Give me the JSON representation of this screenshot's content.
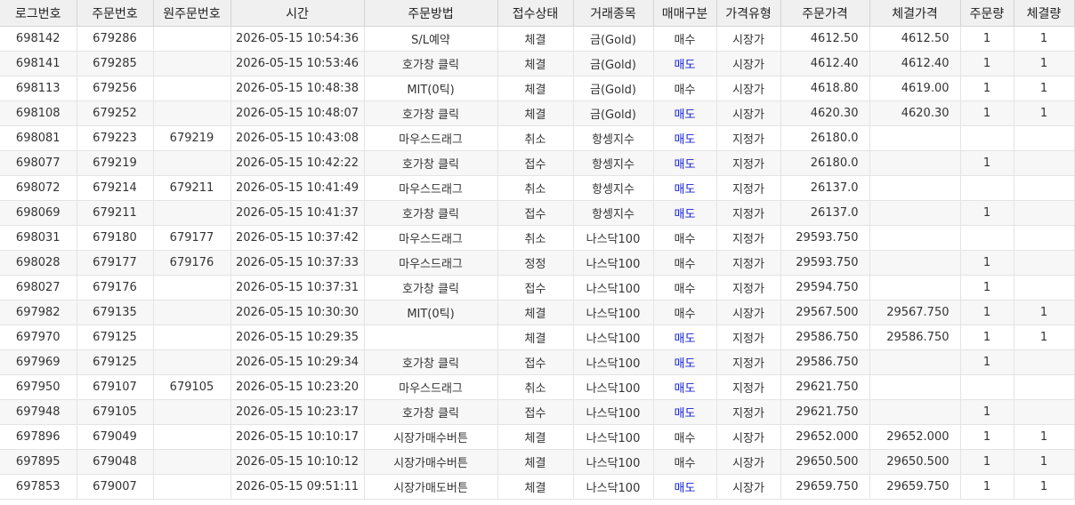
{
  "colors": {
    "sell_text": "#1a24d6",
    "header_bg": "#f0f0f0",
    "row_alt_bg": "#f7f7f7"
  },
  "columns": [
    {
      "key": "log_no",
      "label": "로그번호"
    },
    {
      "key": "order_no",
      "label": "주문번호"
    },
    {
      "key": "orig_order_no",
      "label": "원주문번호"
    },
    {
      "key": "time",
      "label": "시간"
    },
    {
      "key": "method",
      "label": "주문방법"
    },
    {
      "key": "status",
      "label": "접수상태"
    },
    {
      "key": "symbol",
      "label": "거래종목"
    },
    {
      "key": "side",
      "label": "매매구분"
    },
    {
      "key": "price_type",
      "label": "가격유형"
    },
    {
      "key": "order_price",
      "label": "주문가격"
    },
    {
      "key": "fill_price",
      "label": "체결가격"
    },
    {
      "key": "order_qty",
      "label": "주문량"
    },
    {
      "key": "fill_qty",
      "label": "체결량"
    }
  ],
  "rows": [
    {
      "log_no": "698142",
      "order_no": "679286",
      "orig_order_no": "",
      "time": "2026-05-15 10:54:36",
      "method": "S/L예약",
      "status": "체결",
      "symbol": "금(Gold)",
      "side": "매수",
      "price_type": "시장가",
      "order_price": "4612.50",
      "fill_price": "4612.50",
      "order_qty": "1",
      "fill_qty": "1"
    },
    {
      "log_no": "698141",
      "order_no": "679285",
      "orig_order_no": "",
      "time": "2026-05-15 10:53:46",
      "method": "호가창 클릭",
      "status": "체결",
      "symbol": "금(Gold)",
      "side": "매도",
      "price_type": "시장가",
      "order_price": "4612.40",
      "fill_price": "4612.40",
      "order_qty": "1",
      "fill_qty": "1"
    },
    {
      "log_no": "698113",
      "order_no": "679256",
      "orig_order_no": "",
      "time": "2026-05-15 10:48:38",
      "method": "MIT(0틱)",
      "status": "체결",
      "symbol": "금(Gold)",
      "side": "매수",
      "price_type": "시장가",
      "order_price": "4618.80",
      "fill_price": "4619.00",
      "order_qty": "1",
      "fill_qty": "1"
    },
    {
      "log_no": "698108",
      "order_no": "679252",
      "orig_order_no": "",
      "time": "2026-05-15 10:48:07",
      "method": "호가창 클릭",
      "status": "체결",
      "symbol": "금(Gold)",
      "side": "매도",
      "price_type": "시장가",
      "order_price": "4620.30",
      "fill_price": "4620.30",
      "order_qty": "1",
      "fill_qty": "1"
    },
    {
      "log_no": "698081",
      "order_no": "679223",
      "orig_order_no": "679219",
      "time": "2026-05-15 10:43:08",
      "method": "마우스드래그",
      "status": "취소",
      "symbol": "항셍지수",
      "side": "매도",
      "price_type": "지정가",
      "order_price": "26180.0",
      "fill_price": "",
      "order_qty": "",
      "fill_qty": ""
    },
    {
      "log_no": "698077",
      "order_no": "679219",
      "orig_order_no": "",
      "time": "2026-05-15 10:42:22",
      "method": "호가창 클릭",
      "status": "접수",
      "symbol": "항셍지수",
      "side": "매도",
      "price_type": "지정가",
      "order_price": "26180.0",
      "fill_price": "",
      "order_qty": "1",
      "fill_qty": ""
    },
    {
      "log_no": "698072",
      "order_no": "679214",
      "orig_order_no": "679211",
      "time": "2026-05-15 10:41:49",
      "method": "마우스드래그",
      "status": "취소",
      "symbol": "항셍지수",
      "side": "매도",
      "price_type": "지정가",
      "order_price": "26137.0",
      "fill_price": "",
      "order_qty": "",
      "fill_qty": ""
    },
    {
      "log_no": "698069",
      "order_no": "679211",
      "orig_order_no": "",
      "time": "2026-05-15 10:41:37",
      "method": "호가창 클릭",
      "status": "접수",
      "symbol": "항셍지수",
      "side": "매도",
      "price_type": "지정가",
      "order_price": "26137.0",
      "fill_price": "",
      "order_qty": "1",
      "fill_qty": ""
    },
    {
      "log_no": "698031",
      "order_no": "679180",
      "orig_order_no": "679177",
      "time": "2026-05-15 10:37:42",
      "method": "마우스드래그",
      "status": "취소",
      "symbol": "나스닥100",
      "side": "매수",
      "price_type": "지정가",
      "order_price": "29593.750",
      "fill_price": "",
      "order_qty": "",
      "fill_qty": ""
    },
    {
      "log_no": "698028",
      "order_no": "679177",
      "orig_order_no": "679176",
      "time": "2026-05-15 10:37:33",
      "method": "마우스드래그",
      "status": "정정",
      "symbol": "나스닥100",
      "side": "매수",
      "price_type": "지정가",
      "order_price": "29593.750",
      "fill_price": "",
      "order_qty": "1",
      "fill_qty": ""
    },
    {
      "log_no": "698027",
      "order_no": "679176",
      "orig_order_no": "",
      "time": "2026-05-15 10:37:31",
      "method": "호가창 클릭",
      "status": "접수",
      "symbol": "나스닥100",
      "side": "매수",
      "price_type": "지정가",
      "order_price": "29594.750",
      "fill_price": "",
      "order_qty": "1",
      "fill_qty": ""
    },
    {
      "log_no": "697982",
      "order_no": "679135",
      "orig_order_no": "",
      "time": "2026-05-15 10:30:30",
      "method": "MIT(0틱)",
      "status": "체결",
      "symbol": "나스닥100",
      "side": "매수",
      "price_type": "시장가",
      "order_price": "29567.500",
      "fill_price": "29567.750",
      "order_qty": "1",
      "fill_qty": "1"
    },
    {
      "log_no": "697970",
      "order_no": "679125",
      "orig_order_no": "",
      "time": "2026-05-15 10:29:35",
      "method": "",
      "status": "체결",
      "symbol": "나스닥100",
      "side": "매도",
      "price_type": "지정가",
      "order_price": "29586.750",
      "fill_price": "29586.750",
      "order_qty": "1",
      "fill_qty": "1"
    },
    {
      "log_no": "697969",
      "order_no": "679125",
      "orig_order_no": "",
      "time": "2026-05-15 10:29:34",
      "method": "호가창 클릭",
      "status": "접수",
      "symbol": "나스닥100",
      "side": "매도",
      "price_type": "지정가",
      "order_price": "29586.750",
      "fill_price": "",
      "order_qty": "1",
      "fill_qty": ""
    },
    {
      "log_no": "697950",
      "order_no": "679107",
      "orig_order_no": "679105",
      "time": "2026-05-15 10:23:20",
      "method": "마우스드래그",
      "status": "취소",
      "symbol": "나스닥100",
      "side": "매도",
      "price_type": "지정가",
      "order_price": "29621.750",
      "fill_price": "",
      "order_qty": "",
      "fill_qty": ""
    },
    {
      "log_no": "697948",
      "order_no": "679105",
      "orig_order_no": "",
      "time": "2026-05-15 10:23:17",
      "method": "호가창 클릭",
      "status": "접수",
      "symbol": "나스닥100",
      "side": "매도",
      "price_type": "지정가",
      "order_price": "29621.750",
      "fill_price": "",
      "order_qty": "1",
      "fill_qty": ""
    },
    {
      "log_no": "697896",
      "order_no": "679049",
      "orig_order_no": "",
      "time": "2026-05-15 10:10:17",
      "method": "시장가매수버튼",
      "status": "체결",
      "symbol": "나스닥100",
      "side": "매수",
      "price_type": "시장가",
      "order_price": "29652.000",
      "fill_price": "29652.000",
      "order_qty": "1",
      "fill_qty": "1"
    },
    {
      "log_no": "697895",
      "order_no": "679048",
      "orig_order_no": "",
      "time": "2026-05-15 10:10:12",
      "method": "시장가매수버튼",
      "status": "체결",
      "symbol": "나스닥100",
      "side": "매수",
      "price_type": "시장가",
      "order_price": "29650.500",
      "fill_price": "29650.500",
      "order_qty": "1",
      "fill_qty": "1"
    },
    {
      "log_no": "697853",
      "order_no": "679007",
      "orig_order_no": "",
      "time": "2026-05-15 09:51:11",
      "method": "시장가매도버튼",
      "status": "체결",
      "symbol": "나스닥100",
      "side": "매도",
      "price_type": "시장가",
      "order_price": "29659.750",
      "fill_price": "29659.750",
      "order_qty": "1",
      "fill_qty": "1"
    }
  ]
}
